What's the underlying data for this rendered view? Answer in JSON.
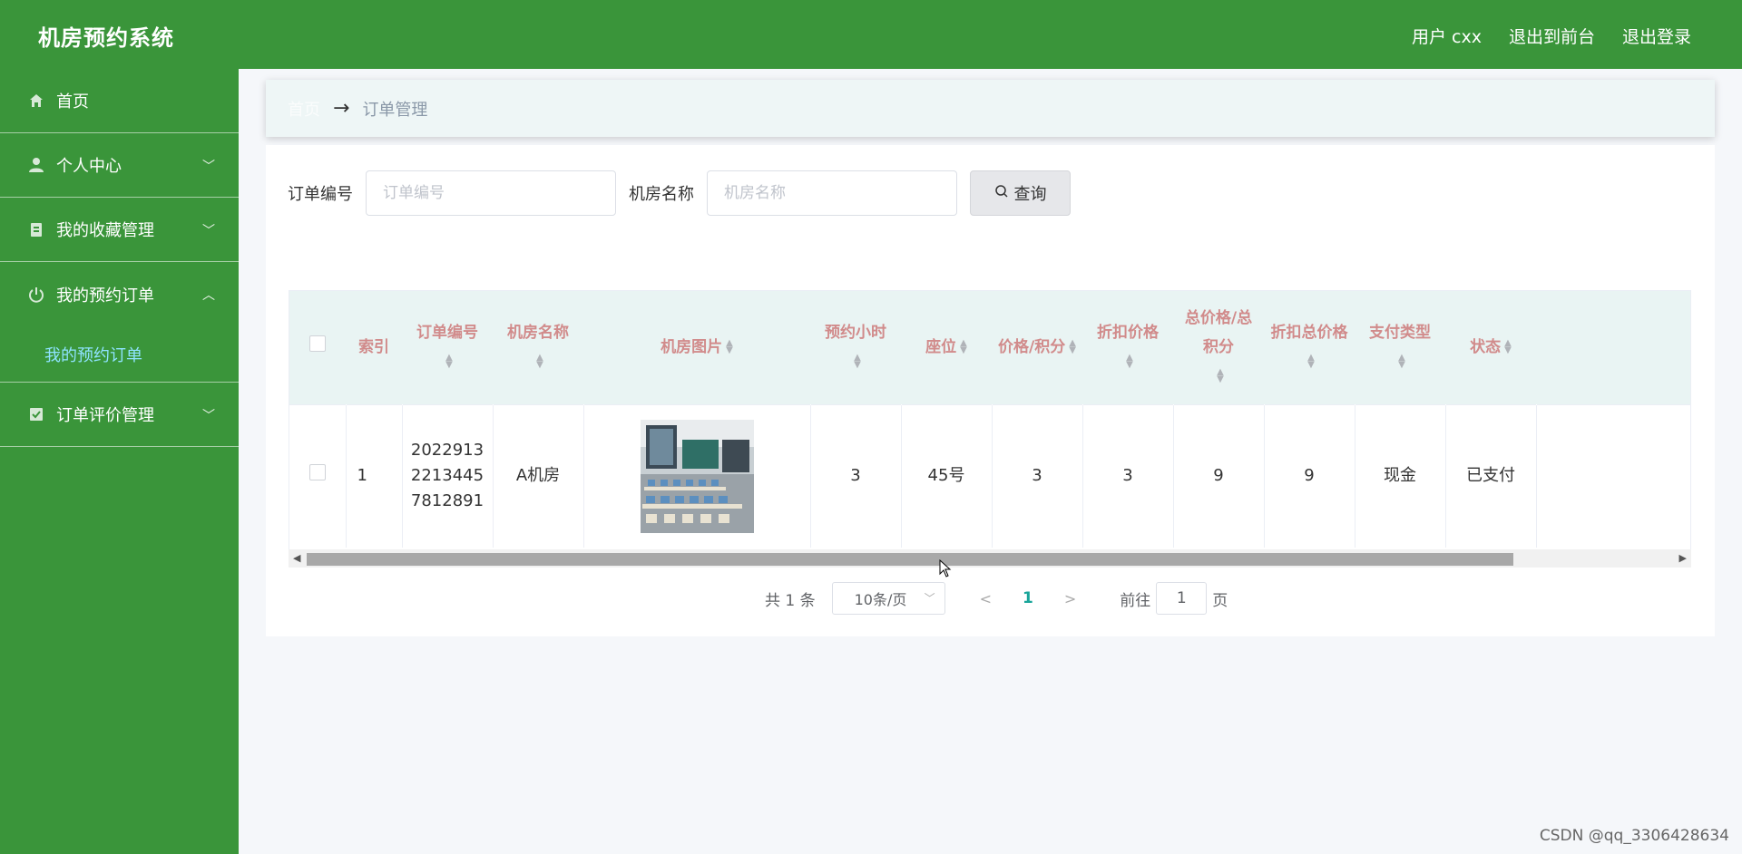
{
  "header": {
    "brand": "机房预约系统",
    "user": "用户 cxx",
    "back_front": "退出到前台",
    "logout": "退出登录"
  },
  "sidebar": {
    "items": [
      {
        "label": "首页",
        "icon": "home-icon"
      },
      {
        "label": "个人中心",
        "icon": "user-icon"
      },
      {
        "label": "我的收藏管理",
        "icon": "collection-icon"
      },
      {
        "label": "我的预约订单",
        "icon": "power-icon"
      },
      {
        "label": "订单评价管理",
        "icon": "checkbox-icon"
      }
    ],
    "submenu_label": "我的预约订单"
  },
  "breadcrumb": {
    "home": "首页",
    "current": "订单管理"
  },
  "search": {
    "order_label": "订单编号",
    "order_placeholder": "订单编号",
    "room_label": "机房名称",
    "room_placeholder": "机房名称",
    "button": "查询"
  },
  "table": {
    "headers": [
      "索引",
      "订单编号",
      "机房名称",
      "机房图片",
      "预约小时",
      "座位",
      "价格/积分",
      "折扣价格",
      "总价格/总积分",
      "折扣总价格",
      "支付类型",
      "状态"
    ],
    "rows": [
      {
        "index": "1",
        "order_no": "20229132213445781 2891",
        "order_no_lines": [
          "2022913",
          "2213445",
          "7812891"
        ],
        "room_name": "A机房",
        "hours": "3",
        "seat": "45号",
        "price": "3",
        "discount_price": "3",
        "total": "9",
        "discount_total": "9",
        "pay_type": "现金",
        "status": "已支付"
      }
    ]
  },
  "pagination": {
    "total": "共 1 条",
    "page_size": "10条/页",
    "current": "1",
    "goto_label": "前往",
    "goto_value": "1",
    "page_suffix": "页"
  },
  "watermark": "CSDN @qq_3306428634",
  "colors": {
    "primary_green": "#3a953a",
    "header_pink": "#d18b8b",
    "active_page": "#1aa59a"
  }
}
